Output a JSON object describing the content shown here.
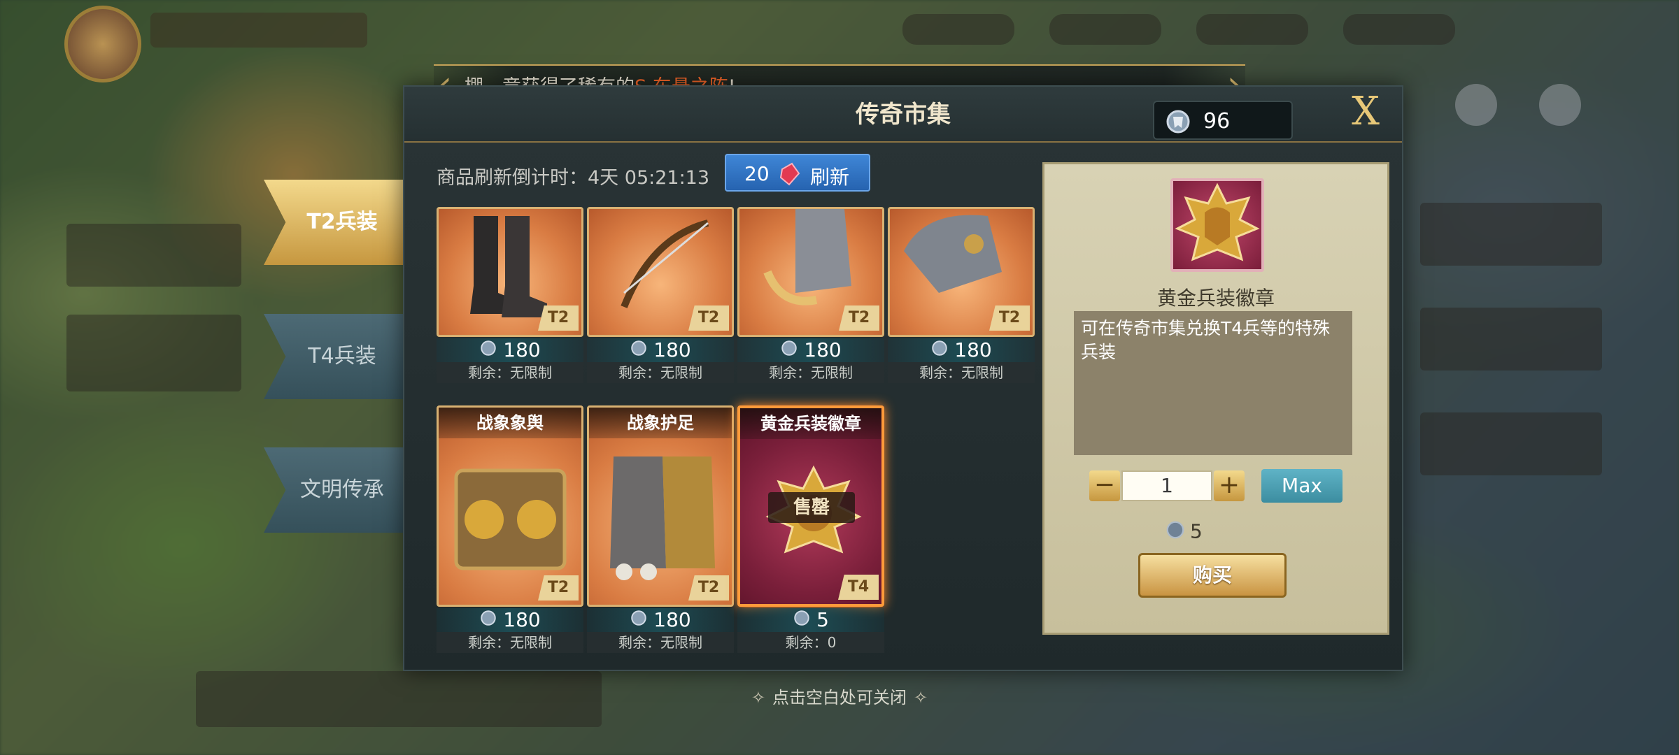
{
  "marquee": {
    "prefix": "棚，竟获得了稀有的",
    "highlight": "S 车悬之阵",
    "suffix": "!"
  },
  "dialog": {
    "title": "传奇市集",
    "currency_value": "96",
    "close_label": "X"
  },
  "refresh": {
    "countdown_label": "商品刷新倒计时：4天 05:21:13",
    "cost": "20",
    "button_label": "刷新"
  },
  "tabs": [
    {
      "label": "T2兵装",
      "active": true
    },
    {
      "label": "T4兵装",
      "active": false
    },
    {
      "label": "文明传承",
      "active": false
    }
  ],
  "items_row1": [
    {
      "name": "",
      "tier": "T2",
      "price": "180",
      "remain": "剩余：无限制"
    },
    {
      "name": "",
      "tier": "T2",
      "price": "180",
      "remain": "剩余：无限制"
    },
    {
      "name": "",
      "tier": "T2",
      "price": "180",
      "remain": "剩余：无限制"
    },
    {
      "name": "",
      "tier": "T2",
      "price": "180",
      "remain": "剩余：无限制"
    }
  ],
  "items_row2": [
    {
      "name": "战象象舆",
      "tier": "T2",
      "price": "180",
      "remain": "剩余：无限制"
    },
    {
      "name": "战象护足",
      "tier": "T2",
      "price": "180",
      "remain": "剩余：无限制"
    },
    {
      "name": "黄金兵装徽章",
      "tier": "T4",
      "price": "5",
      "remain": "剩余：0",
      "sold_label": "售罄"
    }
  ],
  "detail": {
    "name": "黄金兵装徽章",
    "description": "可在传奇市集兑换T4兵等的特殊兵装",
    "quantity": "1",
    "max_label": "Max",
    "cost": "5",
    "buy_label": "购买"
  },
  "close_hint": "点击空白处可关闭",
  "colors": {
    "accent_gold": "#c9a55a",
    "refresh_blue": "#3f86d6",
    "highlight_orange": "#ff6a2a"
  }
}
